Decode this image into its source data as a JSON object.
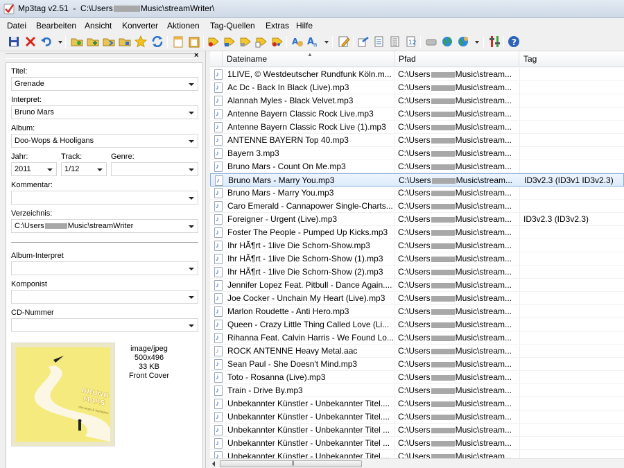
{
  "window": {
    "title_prefix": "Mp3tag v2.51  -  C:\\Users",
    "title_suffix": "Music\\streamWriter\\"
  },
  "menu": [
    "Datei",
    "Bearbeiten",
    "Ansicht",
    "Konverter",
    "Aktionen",
    "Tag-Quellen",
    "Extras",
    "Hilfe"
  ],
  "toolbar_icons": [
    "save-icon",
    "remove-tag-icon",
    "undo-icon",
    "dropdown-arrow-icon",
    "change-directory-icon",
    "add-directory-icon",
    "folder-open-icon",
    "folder-favorite-icon",
    "favorite-star-icon",
    "refresh-icon",
    "copy-tag-icon",
    "paste-tag-icon",
    "tag-to-filename-icon",
    "filename-to-tag-icon",
    "filename-to-filename-icon",
    "text-file-to-tag-icon",
    "tag-to-tag-icon",
    "actions-quick-icon",
    "actions-icon",
    "dropdown-arrow-icon",
    "edit-icon",
    "export-icon",
    "playlist-icon",
    "list-icon",
    "autonumber-icon",
    "freedb-icon",
    "web-source-icon",
    "globe-source-icon",
    "dropdown-arrow-icon",
    "options-icon",
    "help-icon"
  ],
  "tag_panel": {
    "title_label": "Titel:",
    "title_value": "Grenade",
    "artist_label": "Interpret:",
    "artist_value": "Bruno Mars",
    "album_label": "Album:",
    "album_value": "Doo-Wops & Hooligans",
    "year_label": "Jahr:",
    "year_value": "2011",
    "track_label": "Track:",
    "track_value": "1/12",
    "genre_label": "Genre:",
    "genre_value": "",
    "comment_label": "Kommentar:",
    "comment_value": "",
    "directory_label": "Verzeichnis:",
    "directory_prefix": "C:\\Users",
    "directory_suffix": "Music\\streamWriter",
    "album_artist_label": "Album-Interpret",
    "album_artist_value": "",
    "composer_label": "Komponist",
    "composer_value": "",
    "cd_number_label": "CD-Nummer",
    "cd_number_value": "",
    "cover_mime": "image/jpeg",
    "cover_dimensions": "500x496",
    "cover_size": "33 KB",
    "cover_type": "Front Cover",
    "cover_art_text_1": "BRUNO",
    "cover_art_text_2": "MARS",
    "cover_art_text_3": "doo-wops & hooligans"
  },
  "file_list": {
    "columns": [
      "Dateiname",
      "Pfad",
      "Tag"
    ],
    "path_prefix": "C:\\Users",
    "path_suffix": "Music\\stream...",
    "selected_index": 8,
    "rows": [
      {
        "file": "1LIVE, © Westdeutscher Rundfunk Köln.m...",
        "tag": ""
      },
      {
        "file": "Ac Dc - Back In Black (Live).mp3",
        "tag": ""
      },
      {
        "file": "Alannah Myles - Black Velvet.mp3",
        "tag": ""
      },
      {
        "file": "Antenne Bayern Classic Rock Live.mp3",
        "tag": ""
      },
      {
        "file": "Antenne Bayern Classic Rock Live (1).mp3",
        "tag": ""
      },
      {
        "file": "ANTENNE BAYERN Top 40.mp3",
        "tag": ""
      },
      {
        "file": "Bayern 3.mp3",
        "tag": ""
      },
      {
        "file": "Bruno Mars - Count On Me.mp3",
        "tag": ""
      },
      {
        "file": "Bruno Mars - Marry You.mp3",
        "tag": "ID3v2.3 (ID3v1 ID3v2.3)"
      },
      {
        "file": "Bruno Mars - Marry You.mp3",
        "tag": ""
      },
      {
        "file": "Caro Emerald - Cannapower Single-Charts...",
        "tag": ""
      },
      {
        "file": "Foreigner - Urgent (Live).mp3",
        "tag": "ID3v2.3 (ID3v2.3)"
      },
      {
        "file": "Foster The People - Pumped Up Kicks.mp3",
        "tag": ""
      },
      {
        "file": "Ihr HÃ¶rt - 1live Die Schorn-Show.mp3",
        "tag": ""
      },
      {
        "file": "Ihr HÃ¶rt - 1live Die Schorn-Show (1).mp3",
        "tag": ""
      },
      {
        "file": "Ihr HÃ¶rt - 1live Die Schorn-Show (2).mp3",
        "tag": ""
      },
      {
        "file": "Jennifer Lopez Feat. Pitbull - Dance Again....",
        "tag": ""
      },
      {
        "file": "Joe Cocker - Unchain My Heart (Live).mp3",
        "tag": ""
      },
      {
        "file": "Marlon Roudette - Anti Hero.mp3",
        "tag": ""
      },
      {
        "file": "Queen - Crazy Little Thing Called Love (Li...",
        "tag": ""
      },
      {
        "file": "Rihanna Feat. Calvin Harris - We Found Lo...",
        "tag": ""
      },
      {
        "file": "ROCK ANTENNE Heavy Metal.aac",
        "tag": ""
      },
      {
        "file": "Sean Paul - She Doesn't Mind.mp3",
        "tag": ""
      },
      {
        "file": "Toto - Rosanna (Live).mp3",
        "tag": ""
      },
      {
        "file": "Train - Drive By.mp3",
        "tag": ""
      },
      {
        "file": "Unbekannter Künstler - Unbekannter Titel....",
        "tag": ""
      },
      {
        "file": "Unbekannter Künstler - Unbekannter Titel....",
        "tag": ""
      },
      {
        "file": "Unbekannter Künstler - Unbekannter Titel ...",
        "tag": ""
      },
      {
        "file": "Unbekannter Künstler - Unbekannter Titel ...",
        "tag": ""
      },
      {
        "file": "Unbekannter Künstler - Unbekannter Titel....",
        "tag": ""
      }
    ]
  }
}
